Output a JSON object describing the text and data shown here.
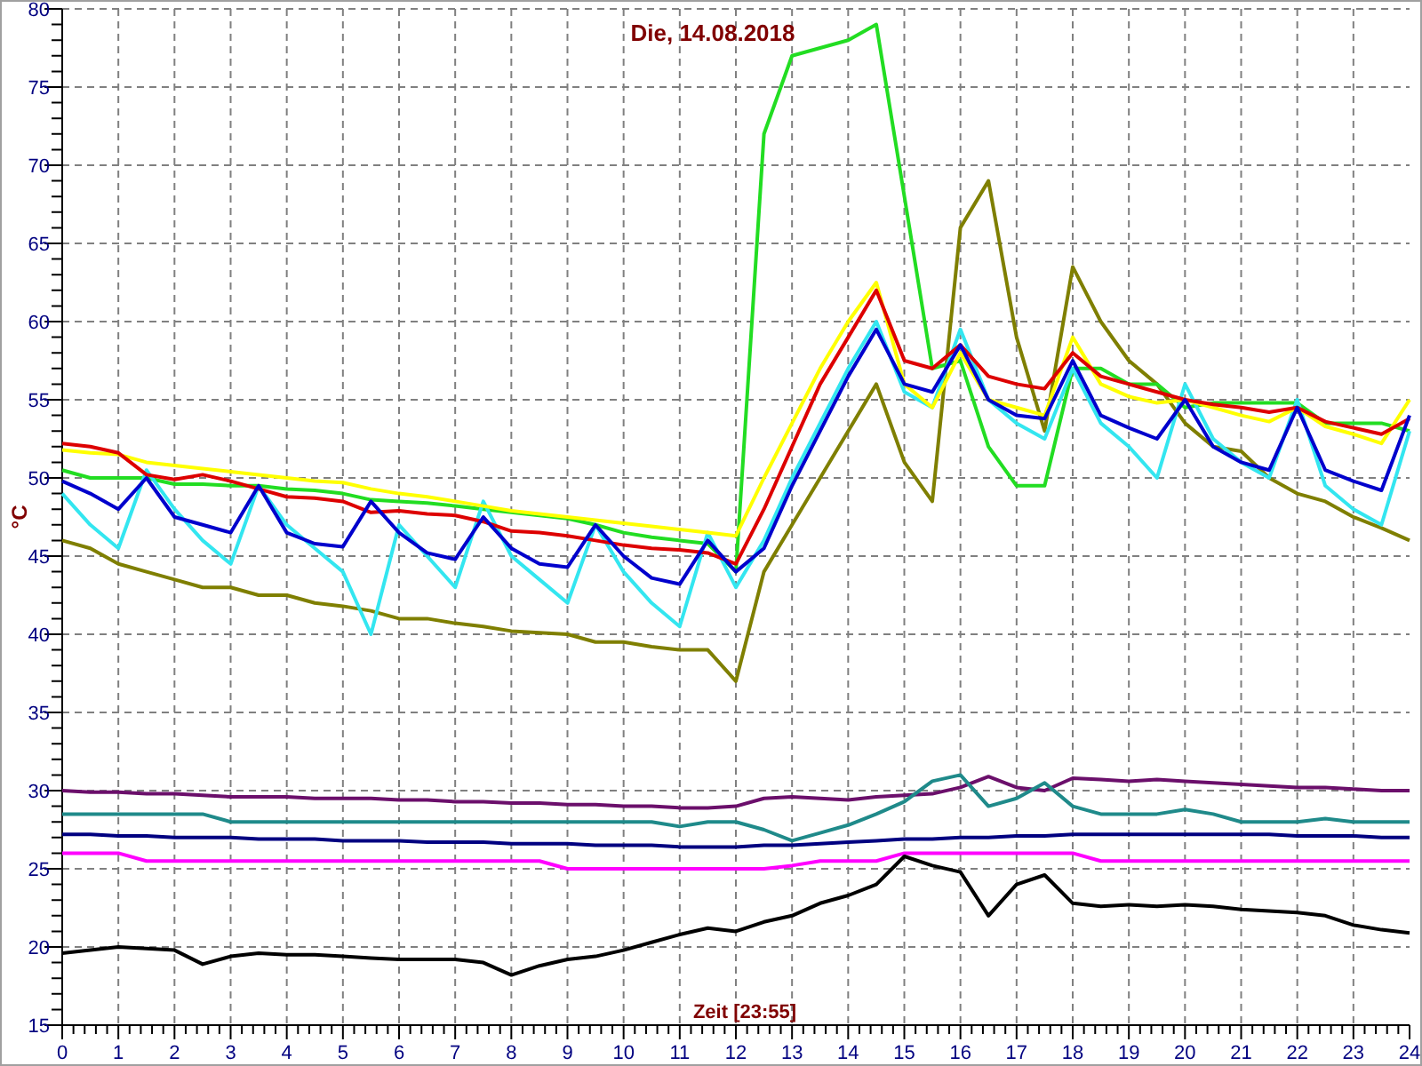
{
  "chart_data": {
    "type": "line",
    "title": "Die, 14.08.2018",
    "xlabel": "Zeit [23:55]",
    "ylabel": "°C",
    "x": [
      0,
      0.5,
      1,
      1.5,
      2,
      2.5,
      3,
      3.5,
      4,
      4.5,
      5,
      5.5,
      6,
      6.5,
      7,
      7.5,
      8,
      8.5,
      9,
      9.5,
      10,
      10.5,
      11,
      11.5,
      12,
      12.5,
      13,
      13.5,
      14,
      14.5,
      15,
      15.5,
      16,
      16.5,
      17,
      17.5,
      18,
      18.5,
      19,
      19.5,
      20,
      20.5,
      21,
      21.5,
      22,
      22.5,
      23,
      23.5,
      24
    ],
    "grid": true,
    "xlim": [
      0,
      24
    ],
    "ylim": [
      15,
      80
    ],
    "xticks": [
      0,
      1,
      2,
      3,
      4,
      5,
      6,
      7,
      8,
      9,
      10,
      11,
      12,
      13,
      14,
      15,
      16,
      17,
      18,
      19,
      20,
      21,
      22,
      23,
      24
    ],
    "yticks": [
      15,
      20,
      25,
      30,
      35,
      40,
      45,
      50,
      55,
      60,
      65,
      70,
      75,
      80
    ],
    "series": [
      {
        "color": "#7f7f00",
        "values": [
          46,
          45.5,
          44.5,
          44,
          43.5,
          43,
          43,
          42.5,
          42.5,
          42,
          41.8,
          41.5,
          41,
          41,
          40.7,
          40.5,
          40.2,
          40.1,
          40,
          39.5,
          39.5,
          39.2,
          39,
          39,
          37,
          44,
          47,
          50,
          53,
          56,
          51,
          48.5,
          66,
          69,
          59,
          53,
          63.5,
          60,
          57.5,
          56,
          53.5,
          52,
          51.7,
          50,
          49,
          48.5,
          47.5,
          46.8,
          46
        ]
      },
      {
        "color": "#22dd22",
        "values": [
          50.5,
          50,
          50,
          50,
          49.6,
          49.6,
          49.5,
          49.5,
          49.3,
          49.2,
          49.0,
          48.6,
          48.5,
          48.4,
          48.2,
          48.0,
          47.8,
          47.6,
          47.4,
          47.0,
          46.5,
          46.2,
          46.0,
          45.8,
          44,
          72,
          77,
          77.5,
          78,
          79,
          68,
          57,
          57.5,
          52,
          49.5,
          49.5,
          57,
          57,
          56,
          56,
          54.5,
          54.8,
          54.8,
          54.8,
          54.8,
          53.5,
          53.5,
          53.5,
          53
        ]
      },
      {
        "color": "#33e6f0",
        "values": [
          49,
          47,
          45.5,
          50.5,
          48,
          46,
          44.5,
          49.5,
          47,
          45.5,
          44,
          40,
          47,
          45,
          43,
          48.5,
          45,
          43.5,
          42,
          47,
          44,
          42,
          40.5,
          46.5,
          43,
          46,
          50,
          53.5,
          57,
          60,
          55.5,
          54.5,
          59.5,
          55,
          53.5,
          52.5,
          57,
          53.5,
          52,
          50,
          56,
          52.5,
          51,
          50,
          55,
          49.5,
          48,
          47,
          53
        ]
      },
      {
        "color": "#ffff00",
        "values": [
          51.8,
          51.6,
          51.5,
          51.0,
          50.8,
          50.6,
          50.4,
          50.2,
          50.0,
          49.8,
          49.7,
          49.3,
          49.0,
          48.8,
          48.5,
          48.2,
          47.9,
          47.7,
          47.5,
          47.3,
          47.1,
          46.9,
          46.7,
          46.5,
          46.3,
          50,
          53.5,
          57,
          60,
          62.5,
          56,
          54.5,
          58,
          55,
          54.5,
          54,
          59,
          56,
          55.2,
          54.8,
          55,
          54.5,
          54.0,
          53.6,
          54.5,
          53.3,
          52.8,
          52.2,
          55
        ]
      },
      {
        "color": "#dd0000",
        "values": [
          52.2,
          52,
          51.6,
          50.2,
          49.9,
          50.2,
          49.8,
          49.3,
          48.8,
          48.7,
          48.5,
          47.8,
          47.9,
          47.7,
          47.6,
          47.2,
          46.6,
          46.5,
          46.3,
          46.0,
          45.7,
          45.5,
          45.4,
          45.2,
          44.5,
          48,
          52,
          56,
          59,
          62,
          57.5,
          57,
          58.5,
          56.5,
          56,
          55.7,
          58,
          56.5,
          56,
          55.5,
          55,
          54.7,
          54.5,
          54.2,
          54.5,
          53.6,
          53.2,
          52.8,
          53.8
        ]
      },
      {
        "color": "#0000cc",
        "values": [
          49.8,
          49,
          48,
          50,
          47.5,
          47,
          46.5,
          49.5,
          46.5,
          45.8,
          45.6,
          48.5,
          46.5,
          45.2,
          44.8,
          47.5,
          45.5,
          44.5,
          44.3,
          47,
          45,
          43.6,
          43.2,
          46,
          44,
          45.5,
          49.5,
          53,
          56.5,
          59.5,
          56,
          55.5,
          58.5,
          55,
          54,
          53.8,
          57.5,
          54,
          53.2,
          52.5,
          55,
          52,
          51,
          50.5,
          54.5,
          50.5,
          49.8,
          49.2,
          54
        ]
      },
      {
        "color": "#6b0f6b",
        "values": [
          30,
          29.9,
          29.9,
          29.8,
          29.8,
          29.7,
          29.6,
          29.6,
          29.6,
          29.5,
          29.5,
          29.5,
          29.4,
          29.4,
          29.3,
          29.3,
          29.2,
          29.2,
          29.1,
          29.1,
          29.0,
          29.0,
          28.9,
          28.9,
          29.0,
          29.5,
          29.6,
          29.5,
          29.4,
          29.6,
          29.7,
          29.8,
          30.2,
          30.9,
          30.2,
          30.0,
          30.8,
          30.7,
          30.6,
          30.7,
          30.6,
          30.5,
          30.4,
          30.3,
          30.2,
          30.2,
          30.1,
          30.0,
          30
        ]
      },
      {
        "color": "#1f8a8a",
        "values": [
          28.5,
          28.5,
          28.5,
          28.5,
          28.5,
          28.5,
          28,
          28,
          28,
          28,
          28,
          28,
          28,
          28,
          28,
          28,
          28,
          28,
          28,
          28,
          28,
          28,
          27.7,
          28,
          28,
          27.5,
          26.8,
          27.3,
          27.8,
          28.5,
          29.3,
          30.6,
          31.0,
          29,
          29.5,
          30.5,
          29,
          28.5,
          28.5,
          28.5,
          28.8,
          28.5,
          28,
          28,
          28,
          28.2,
          28,
          28,
          28
        ]
      },
      {
        "color": "#000080",
        "values": [
          27.2,
          27.2,
          27.1,
          27.1,
          27.0,
          27.0,
          27.0,
          26.9,
          26.9,
          26.9,
          26.8,
          26.8,
          26.8,
          26.7,
          26.7,
          26.7,
          26.6,
          26.6,
          26.6,
          26.5,
          26.5,
          26.5,
          26.4,
          26.4,
          26.4,
          26.5,
          26.5,
          26.6,
          26.7,
          26.8,
          26.9,
          26.9,
          27.0,
          27.0,
          27.1,
          27.1,
          27.2,
          27.2,
          27.2,
          27.2,
          27.2,
          27.2,
          27.2,
          27.2,
          27.1,
          27.1,
          27.1,
          27.0,
          27.0
        ]
      },
      {
        "color": "#ff00ff",
        "values": [
          26,
          26,
          26,
          25.5,
          25.5,
          25.5,
          25.5,
          25.5,
          25.5,
          25.5,
          25.5,
          25.5,
          25.5,
          25.5,
          25.5,
          25.5,
          25.5,
          25.5,
          25,
          25,
          25,
          25,
          25,
          25,
          25,
          25,
          25.2,
          25.5,
          25.5,
          25.5,
          26,
          26,
          26,
          26,
          26,
          26,
          26,
          25.5,
          25.5,
          25.5,
          25.5,
          25.5,
          25.5,
          25.5,
          25.5,
          25.5,
          25.5,
          25.5,
          25.5
        ]
      },
      {
        "color": "#000000",
        "values": [
          19.6,
          19.8,
          20,
          19.9,
          19.8,
          18.9,
          19.4,
          19.6,
          19.5,
          19.5,
          19.4,
          19.3,
          19.2,
          19.2,
          19.2,
          19.0,
          18.2,
          18.8,
          19.2,
          19.4,
          19.8,
          20.3,
          20.8,
          21.2,
          21.0,
          21.6,
          22,
          22.8,
          23.3,
          24,
          25.8,
          25.2,
          24.8,
          22,
          24,
          24.6,
          22.8,
          22.6,
          22.7,
          22.6,
          22.7,
          22.6,
          22.4,
          22.3,
          22.2,
          22,
          21.4,
          21.1,
          20.9
        ]
      }
    ]
  }
}
